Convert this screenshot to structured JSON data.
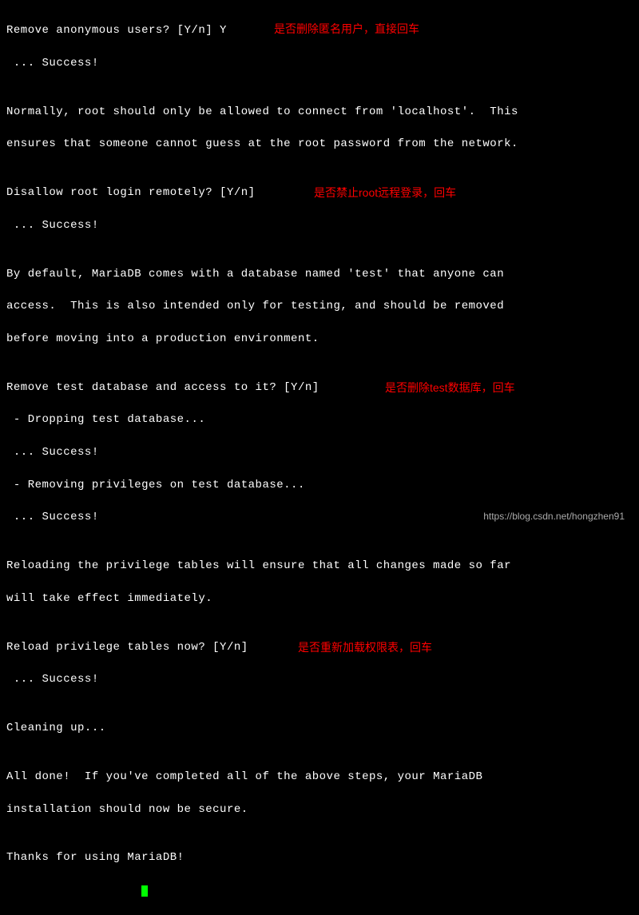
{
  "terminal": {
    "l1": "Remove anonymous users? [Y/n] Y",
    "l2": " ... Success!",
    "l3": "",
    "l4": "Normally, root should only be allowed to connect from 'localhost'.  This",
    "l5": "ensures that someone cannot guess at the root password from the network.",
    "l6": "",
    "l7": "Disallow root login remotely? [Y/n]",
    "l8": " ... Success!",
    "l9": "",
    "l10": "By default, MariaDB comes with a database named 'test' that anyone can",
    "l11": "access.  This is also intended only for testing, and should be removed",
    "l12": "before moving into a production environment.",
    "l13": "",
    "l14": "Remove test database and access to it? [Y/n]",
    "l15": " - Dropping test database...",
    "l16": " ... Success!",
    "l17": " - Removing privileges on test database...",
    "l18": " ... Success!",
    "l19": "",
    "l20": "Reloading the privilege tables will ensure that all changes made so far",
    "l21": "will take effect immediately.",
    "l22": "",
    "l23": "Reload privilege tables now? [Y/n]",
    "l24": " ... Success!",
    "l25": "",
    "l26": "Cleaning up...",
    "l27": "",
    "l28": "All done!  If you've completed all of the above steps, your MariaDB",
    "l29": "installation should now be secure.",
    "l30": "",
    "l31": "Thanks for using MariaDB!"
  },
  "annotations": {
    "a1": "是否删除匿名用户，直接回车",
    "a2": "是否禁止root远程登录，回车",
    "a3": "是否删除test数据库，回车",
    "a4": "是否重新加载权限表，回车"
  },
  "watermark": "https://blog.csdn.net/hongzhen91"
}
